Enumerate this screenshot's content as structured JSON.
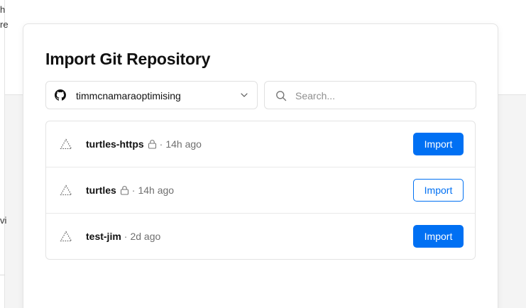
{
  "background": {
    "fragments": [
      "h",
      "re",
      "vi"
    ]
  },
  "modal": {
    "title": "Import Git Repository",
    "scope": {
      "label": "timmcnamaraoptimising",
      "icon": "github-icon"
    },
    "search": {
      "placeholder": "Search...",
      "value": ""
    },
    "repos": [
      {
        "name": "turtles-https",
        "private": true,
        "separator": "·",
        "age": "14h ago",
        "button_label": "Import",
        "button_style": "solid"
      },
      {
        "name": "turtles",
        "private": true,
        "separator": "·",
        "age": "14h ago",
        "button_label": "Import",
        "button_style": "outline"
      },
      {
        "name": "test-jim",
        "private": false,
        "separator": "·",
        "age": "2d ago",
        "button_label": "Import",
        "button_style": "solid"
      }
    ]
  },
  "colors": {
    "accent": "#0070f3",
    "text": "#111111",
    "muted": "#6f6f6f",
    "border": "#e1e1e1"
  }
}
